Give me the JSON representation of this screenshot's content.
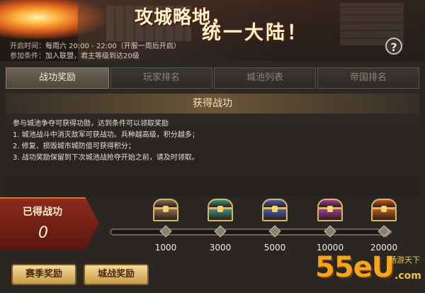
{
  "banner": {
    "slogan_line1": "攻城略地，",
    "slogan_line2": "统一大陆！",
    "open_time_label": "开启时间：",
    "open_time_value": "每周六 20:00 - 22:00（开服一周后开启）",
    "condition_label": "参加条件：",
    "condition_value": "加入联盟，君主等级到达20级",
    "help_symbol": "?"
  },
  "tabs": [
    {
      "label": "战功奖励",
      "active": true
    },
    {
      "label": "玩家排名",
      "active": false
    },
    {
      "label": "城池列表",
      "active": false
    },
    {
      "label": "帝国排名",
      "active": false
    }
  ],
  "section": {
    "title": "获得战功",
    "lines": [
      "参与城池争夺可获得功勋，达到条件可以领取奖励",
      "1. 城池战斗中消灭敌军可获战功。兵种越高级，积分越多；",
      "2. 修复、损毁城市城防值可获得积分；",
      "3. 战功奖励保留到下次城池战抢夺开始之前，请及时领取。"
    ]
  },
  "earned": {
    "label": "已得战功",
    "value": "0"
  },
  "milestones": [
    {
      "threshold": "1000",
      "chest_color": "#8a6a55",
      "chest_icon": "brown-chest-icon"
    },
    {
      "threshold": "3000",
      "chest_color": "#3f8e86",
      "chest_icon": "teal-chest-icon"
    },
    {
      "threshold": "5000",
      "chest_color": "#4a5fb0",
      "chest_icon": "blue-chest-icon"
    },
    {
      "threshold": "10000",
      "chest_color": "#a63a9a",
      "chest_icon": "purple-chest-icon"
    },
    {
      "threshold": "20000",
      "chest_color": "#c2571f",
      "chest_icon": "orange-chest-icon"
    }
  ],
  "buttons": {
    "season_reward": "赛季奖励",
    "city_battle_reward": "城战奖励"
  },
  "watermark": {
    "brand": "55eU",
    "tagline": "畅游天下",
    "url": ".com"
  }
}
